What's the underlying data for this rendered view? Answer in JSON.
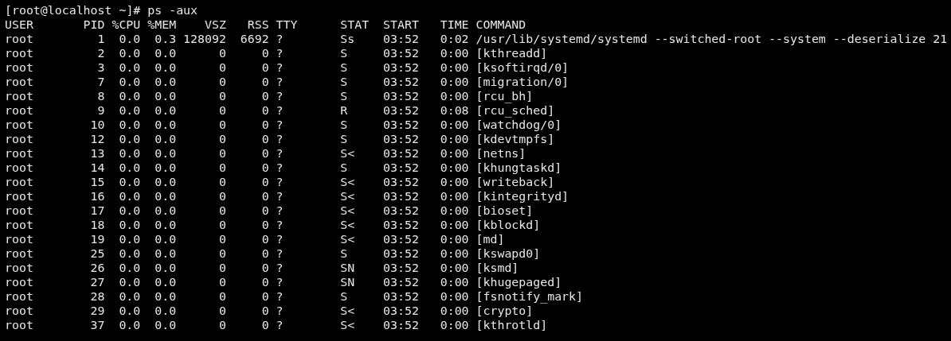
{
  "terminal": {
    "prompt": "[root@localhost ~]# ps -aux",
    "columns": [
      "USER",
      "PID",
      "%CPU",
      "%MEM",
      "VSZ",
      "RSS",
      "TTY",
      "STAT",
      "START",
      "TIME",
      "COMMAND"
    ],
    "rows": [
      [
        "root",
        "1",
        "0.0",
        "0.3",
        "128092",
        "6692",
        "?",
        "Ss",
        "03:52",
        "0:02",
        "/usr/lib/systemd/systemd --switched-root --system --deserialize 21"
      ],
      [
        "root",
        "2",
        "0.0",
        "0.0",
        "0",
        "0",
        "?",
        "S",
        "03:52",
        "0:00",
        "[kthreadd]"
      ],
      [
        "root",
        "3",
        "0.0",
        "0.0",
        "0",
        "0",
        "?",
        "S",
        "03:52",
        "0:00",
        "[ksoftirqd/0]"
      ],
      [
        "root",
        "7",
        "0.0",
        "0.0",
        "0",
        "0",
        "?",
        "S",
        "03:52",
        "0:00",
        "[migration/0]"
      ],
      [
        "root",
        "8",
        "0.0",
        "0.0",
        "0",
        "0",
        "?",
        "S",
        "03:52",
        "0:00",
        "[rcu_bh]"
      ],
      [
        "root",
        "9",
        "0.0",
        "0.0",
        "0",
        "0",
        "?",
        "R",
        "03:52",
        "0:08",
        "[rcu_sched]"
      ],
      [
        "root",
        "10",
        "0.0",
        "0.0",
        "0",
        "0",
        "?",
        "S",
        "03:52",
        "0:00",
        "[watchdog/0]"
      ],
      [
        "root",
        "12",
        "0.0",
        "0.0",
        "0",
        "0",
        "?",
        "S",
        "03:52",
        "0:00",
        "[kdevtmpfs]"
      ],
      [
        "root",
        "13",
        "0.0",
        "0.0",
        "0",
        "0",
        "?",
        "S<",
        "03:52",
        "0:00",
        "[netns]"
      ],
      [
        "root",
        "14",
        "0.0",
        "0.0",
        "0",
        "0",
        "?",
        "S",
        "03:52",
        "0:00",
        "[khungtaskd]"
      ],
      [
        "root",
        "15",
        "0.0",
        "0.0",
        "0",
        "0",
        "?",
        "S<",
        "03:52",
        "0:00",
        "[writeback]"
      ],
      [
        "root",
        "16",
        "0.0",
        "0.0",
        "0",
        "0",
        "?",
        "S<",
        "03:52",
        "0:00",
        "[kintegrityd]"
      ],
      [
        "root",
        "17",
        "0.0",
        "0.0",
        "0",
        "0",
        "?",
        "S<",
        "03:52",
        "0:00",
        "[bioset]"
      ],
      [
        "root",
        "18",
        "0.0",
        "0.0",
        "0",
        "0",
        "?",
        "S<",
        "03:52",
        "0:00",
        "[kblockd]"
      ],
      [
        "root",
        "19",
        "0.0",
        "0.0",
        "0",
        "0",
        "?",
        "S<",
        "03:52",
        "0:00",
        "[md]"
      ],
      [
        "root",
        "25",
        "0.0",
        "0.0",
        "0",
        "0",
        "?",
        "S",
        "03:52",
        "0:00",
        "[kswapd0]"
      ],
      [
        "root",
        "26",
        "0.0",
        "0.0",
        "0",
        "0",
        "?",
        "SN",
        "03:52",
        "0:00",
        "[ksmd]"
      ],
      [
        "root",
        "27",
        "0.0",
        "0.0",
        "0",
        "0",
        "?",
        "SN",
        "03:52",
        "0:00",
        "[khugepaged]"
      ],
      [
        "root",
        "28",
        "0.0",
        "0.0",
        "0",
        "0",
        "?",
        "S",
        "03:52",
        "0:00",
        "[fsnotify_mark]"
      ],
      [
        "root",
        "29",
        "0.0",
        "0.0",
        "0",
        "0",
        "?",
        "S<",
        "03:52",
        "0:00",
        "[crypto]"
      ],
      [
        "root",
        "37",
        "0.0",
        "0.0",
        "0",
        "0",
        "?",
        "S<",
        "03:52",
        "0:00",
        "[kthrotld]"
      ]
    ]
  }
}
